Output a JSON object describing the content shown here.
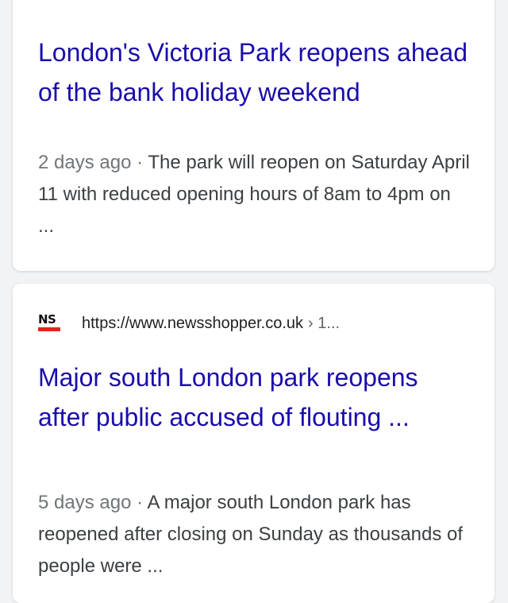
{
  "results": [
    {
      "title": "London's Victoria Park reopens ahead of the bank holiday weekend",
      "date": "2 days ago",
      "separator": "·",
      "snippet": "The park will reopen on Saturday April 11 with reduced opening hours of 8am to 4pm on ..."
    },
    {
      "favicon_text": "NS",
      "url": "https://www.newsshopper.co.uk",
      "breadcrumb": "› 1...",
      "title": "Major south London park reopens after public accused of flouting ...",
      "date": "5 days ago",
      "separator": "·",
      "snippet": "A major south London park has reopened after closing on Sunday as thousands of people were ..."
    }
  ],
  "colors": {
    "link": "#1a0dab",
    "snippet_text": "#3c4043",
    "date_text": "#70757a",
    "favicon_bar": "#e1261c",
    "background": "#f1f3f4"
  }
}
